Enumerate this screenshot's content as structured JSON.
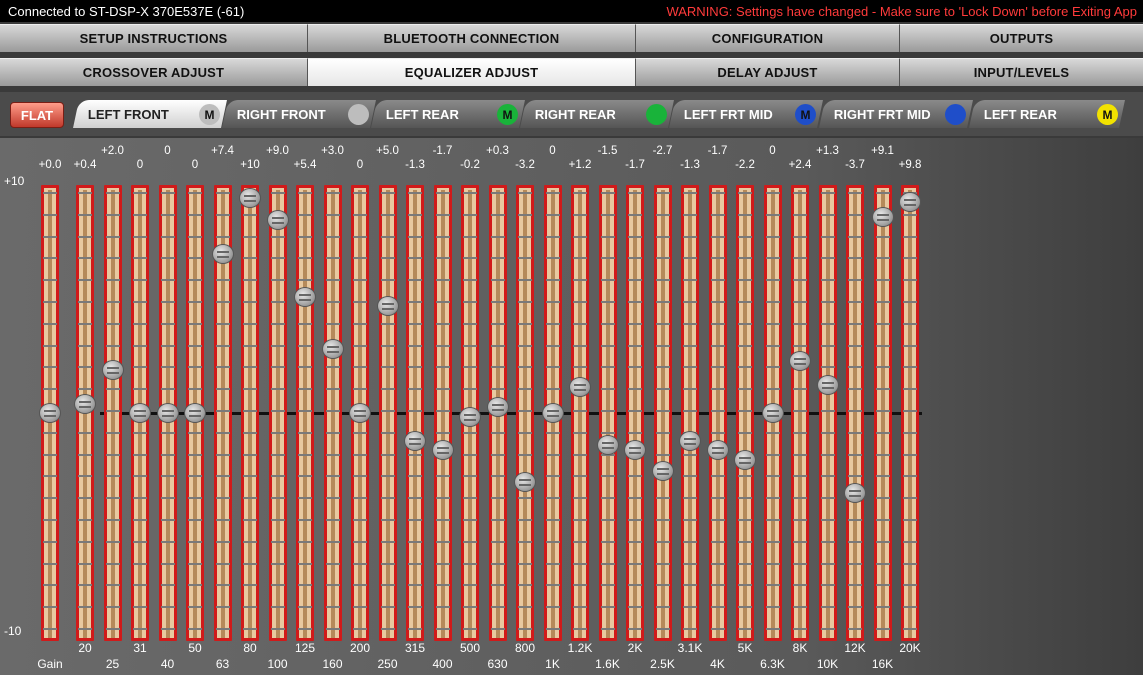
{
  "status": {
    "connection": "Connected to ST-DSP-X  370E537E (-61)",
    "warning": "WARNING: Settings have changed - Make sure to 'Lock Down' before Exiting App"
  },
  "tabs_row1": [
    "SETUP INSTRUCTIONS",
    "BLUETOOTH CONNECTION",
    "CONFIGURATION",
    "OUTPUTS"
  ],
  "tabs_row2": [
    "CROSSOVER ADJUST",
    "EQUALIZER ADJUST",
    "DELAY ADJUST",
    "INPUT/LEVELS"
  ],
  "active_tab": "EQUALIZER ADJUST",
  "flat_label": "FLAT",
  "channels": [
    {
      "label": "LEFT FRONT",
      "marker": "M",
      "marker_color": "#bdbdbd",
      "active": true
    },
    {
      "label": "RIGHT FRONT",
      "marker": "",
      "marker_color": "#bdbdbd",
      "active": false
    },
    {
      "label": "LEFT REAR",
      "marker": "M",
      "marker_color": "#19b33a",
      "active": false
    },
    {
      "label": "RIGHT REAR",
      "marker": "",
      "marker_color": "#19b33a",
      "active": false
    },
    {
      "label": "LEFT FRT MID",
      "marker": "M",
      "marker_color": "#1f4ec9",
      "active": false
    },
    {
      "label": "RIGHT FRT MID",
      "marker": "",
      "marker_color": "#1f4ec9",
      "active": false
    },
    {
      "label": "LEFT REAR",
      "marker": "M",
      "marker_color": "#f2e200",
      "active": false
    }
  ],
  "axis": {
    "top": "+10",
    "bottom": "-10"
  },
  "gain_label": "Gain",
  "bands": [
    {
      "freq": "20",
      "value": "+0.4"
    },
    {
      "freq": "25",
      "value": "+2.0"
    },
    {
      "freq": "31",
      "value": "0"
    },
    {
      "freq": "40",
      "value": "0"
    },
    {
      "freq": "50",
      "value": "0"
    },
    {
      "freq": "63",
      "value": "+7.4"
    },
    {
      "freq": "80",
      "value": "+10"
    },
    {
      "freq": "100",
      "value": "+9.0"
    },
    {
      "freq": "125",
      "value": "+5.4"
    },
    {
      "freq": "160",
      "value": "+3.0"
    },
    {
      "freq": "200",
      "value": "0"
    },
    {
      "freq": "250",
      "value": "+5.0"
    },
    {
      "freq": "315",
      "value": "-1.3"
    },
    {
      "freq": "400",
      "value": "-1.7"
    },
    {
      "freq": "500",
      "value": "-0.2"
    },
    {
      "freq": "630",
      "value": "+0.3"
    },
    {
      "freq": "800",
      "value": "-3.2"
    },
    {
      "freq": "1K",
      "value": "0"
    },
    {
      "freq": "1.2K",
      "value": "+1.2"
    },
    {
      "freq": "1.6K",
      "value": "-1.5"
    },
    {
      "freq": "2K",
      "value": "-1.7"
    },
    {
      "freq": "2.5K",
      "value": "-2.7"
    },
    {
      "freq": "3.1K",
      "value": "-1.3"
    },
    {
      "freq": "4K",
      "value": "-1.7"
    },
    {
      "freq": "5K",
      "value": "-2.2"
    },
    {
      "freq": "6.3K",
      "value": "0"
    },
    {
      "freq": "8K",
      "value": "+2.4"
    },
    {
      "freq": "10K",
      "value": "+1.3"
    },
    {
      "freq": "12K",
      "value": "-3.7"
    },
    {
      "freq": "16K",
      "value": "+9.1"
    },
    {
      "freq": "20K",
      "value": "+9.8"
    }
  ],
  "gain": {
    "value": "+0.0"
  }
}
